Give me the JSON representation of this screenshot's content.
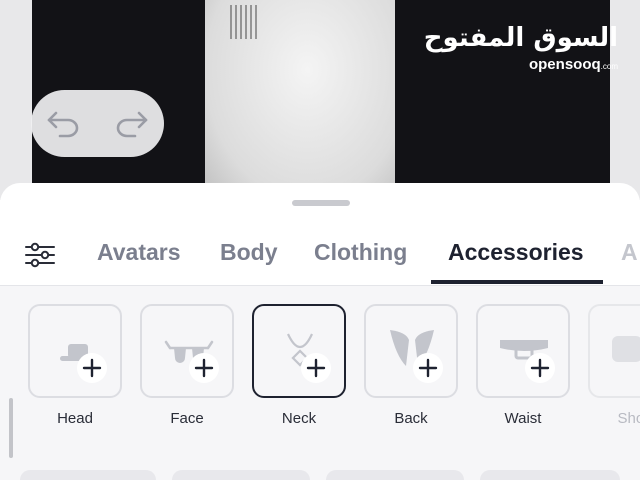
{
  "watermark": {
    "arabic": "السوق المفتوح",
    "domain_main": "opensooq",
    "domain_tld": ".com"
  },
  "editor": {
    "undo_icon": "undo-icon",
    "redo_icon": "redo-icon"
  },
  "tabs": [
    {
      "label": "Avatars",
      "active": false
    },
    {
      "label": "Body",
      "active": false
    },
    {
      "label": "Clothing",
      "active": false
    },
    {
      "label": "Accessories",
      "active": true
    },
    {
      "label": "A",
      "active": false
    }
  ],
  "categories": [
    {
      "label": "Head",
      "icon": "hat-icon",
      "selected": false
    },
    {
      "label": "Face",
      "icon": "glasses-icon",
      "selected": false
    },
    {
      "label": "Neck",
      "icon": "necklace-icon",
      "selected": true
    },
    {
      "label": "Back",
      "icon": "wings-icon",
      "selected": false
    },
    {
      "label": "Waist",
      "icon": "belt-icon",
      "selected": false
    },
    {
      "label": "Shou",
      "icon": "shoulder-icon",
      "selected": false
    }
  ],
  "colors": {
    "active_text": "#1e2230",
    "inactive_text": "#7b7f8e",
    "icon_gray": "#c3c5cc"
  }
}
